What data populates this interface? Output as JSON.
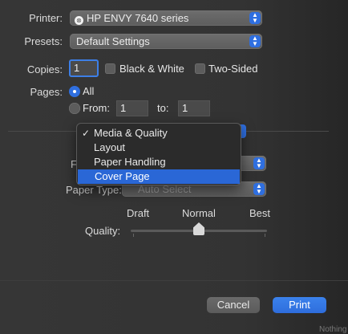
{
  "printer": {
    "label": "Printer:",
    "value": "HP ENVY 7640 series"
  },
  "presets": {
    "label": "Presets:",
    "value": "Default Settings"
  },
  "copies": {
    "label": "Copies:",
    "value": "1",
    "black_white": "Black & White",
    "two_sided": "Two-Sided"
  },
  "pages": {
    "label": "Pages:",
    "all": "All",
    "from_label": "From:",
    "from_value": "1",
    "to_label": "to:",
    "to_value": "1"
  },
  "panel_menu": {
    "items": [
      {
        "label": "Media & Quality",
        "checked": true
      },
      {
        "label": "Layout"
      },
      {
        "label": "Paper Handling"
      },
      {
        "label": "Cover Page",
        "highlighted": true
      }
    ]
  },
  "media": {
    "feed_label_partial": "F",
    "paper_type_label": "Paper Type:",
    "paper_type_value": "Auto Select"
  },
  "quality": {
    "label": "Quality:",
    "draft": "Draft",
    "normal": "Normal",
    "best": "Best",
    "level": 0.5
  },
  "buttons": {
    "cancel": "Cancel",
    "print": "Print"
  },
  "footer_partial": "Nothing"
}
